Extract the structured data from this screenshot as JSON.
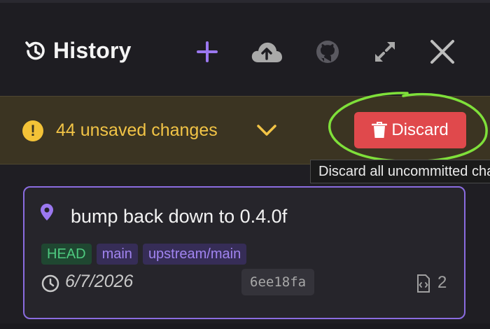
{
  "header": {
    "title": "History",
    "icons": [
      "history-icon",
      "plus-icon",
      "cloud-upload-icon",
      "github-icon",
      "expand-icon",
      "close-icon"
    ],
    "accent": "#9b78f0"
  },
  "banner": {
    "warning_text": "44 unsaved changes",
    "discard_label": "Discard",
    "tooltip": "Discard all uncommitted changes",
    "warning_color": "#f2c446",
    "discard_color": "#e0494c"
  },
  "commit": {
    "message": "bump back down to 0.4.0f",
    "tags": [
      {
        "label": "HEAD"
      },
      {
        "label": "main"
      },
      {
        "label": "upstream/main"
      }
    ],
    "date": "6/7/2026",
    "sha": "6ee18fa",
    "files_changed": "2"
  }
}
